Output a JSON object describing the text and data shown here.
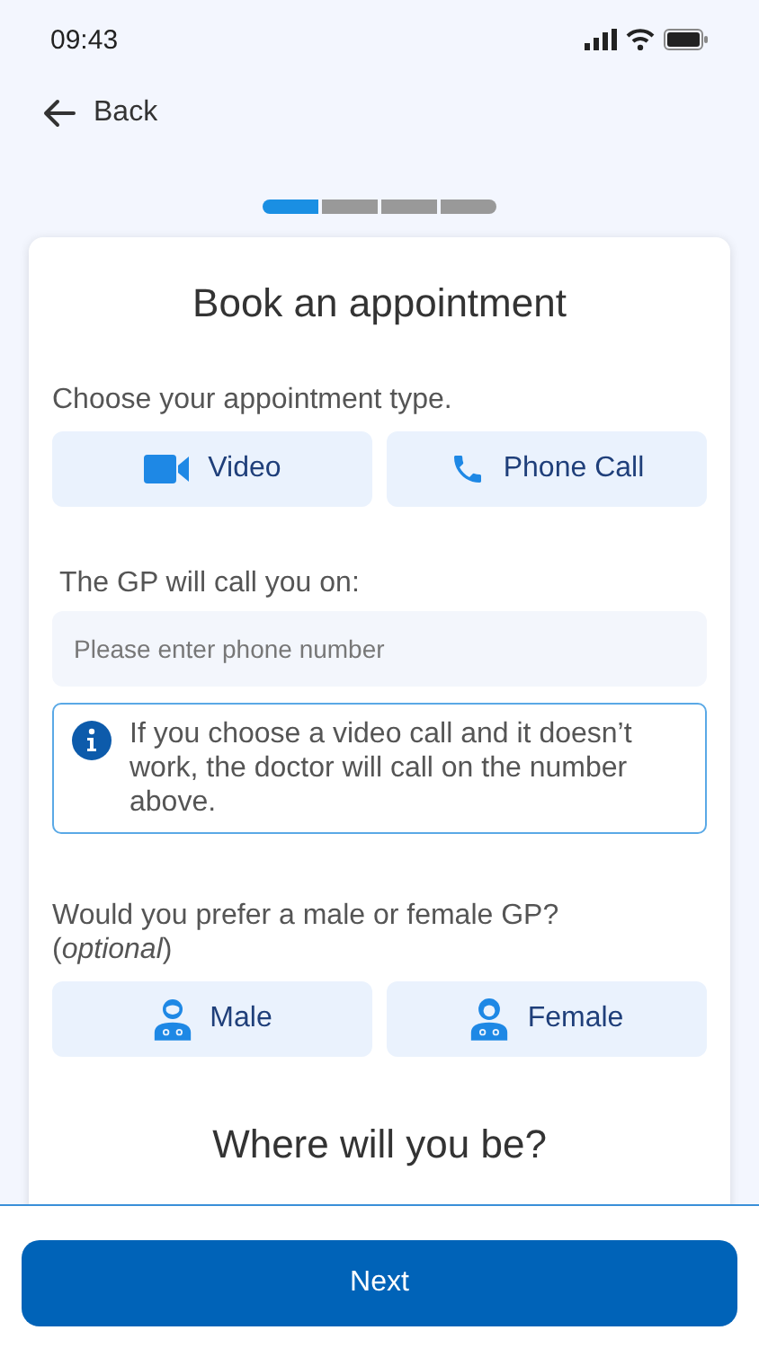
{
  "status_bar": {
    "time": "09:43"
  },
  "back": {
    "label": "Back"
  },
  "progress": [
    {
      "done": true
    },
    {
      "done": false
    },
    {
      "done": false
    },
    {
      "done": false
    }
  ],
  "card": {
    "title": "Book an appointment",
    "type_prompt": "Choose your appointment type.",
    "type_options": [
      {
        "kind": "video",
        "label": "Video"
      },
      {
        "kind": "phone",
        "label": "Phone Call"
      }
    ],
    "phone_label": "The GP will call you on:",
    "phone_field": {
      "placeholder": "Please enter phone number"
    },
    "info": "If you choose a video call and it  doesn’t work, the doctor will call on the number above.",
    "gender_prompt": "Would you prefer a male or female GP?",
    "gender_note": "(*optional*)",
    "gender_options": [
      {
        "kind": "male",
        "label": "Male"
      },
      {
        "kind": "female",
        "label": "Female"
      }
    ],
    "location_title": "Where will you be?"
  },
  "footer": {
    "button": "Next"
  }
}
